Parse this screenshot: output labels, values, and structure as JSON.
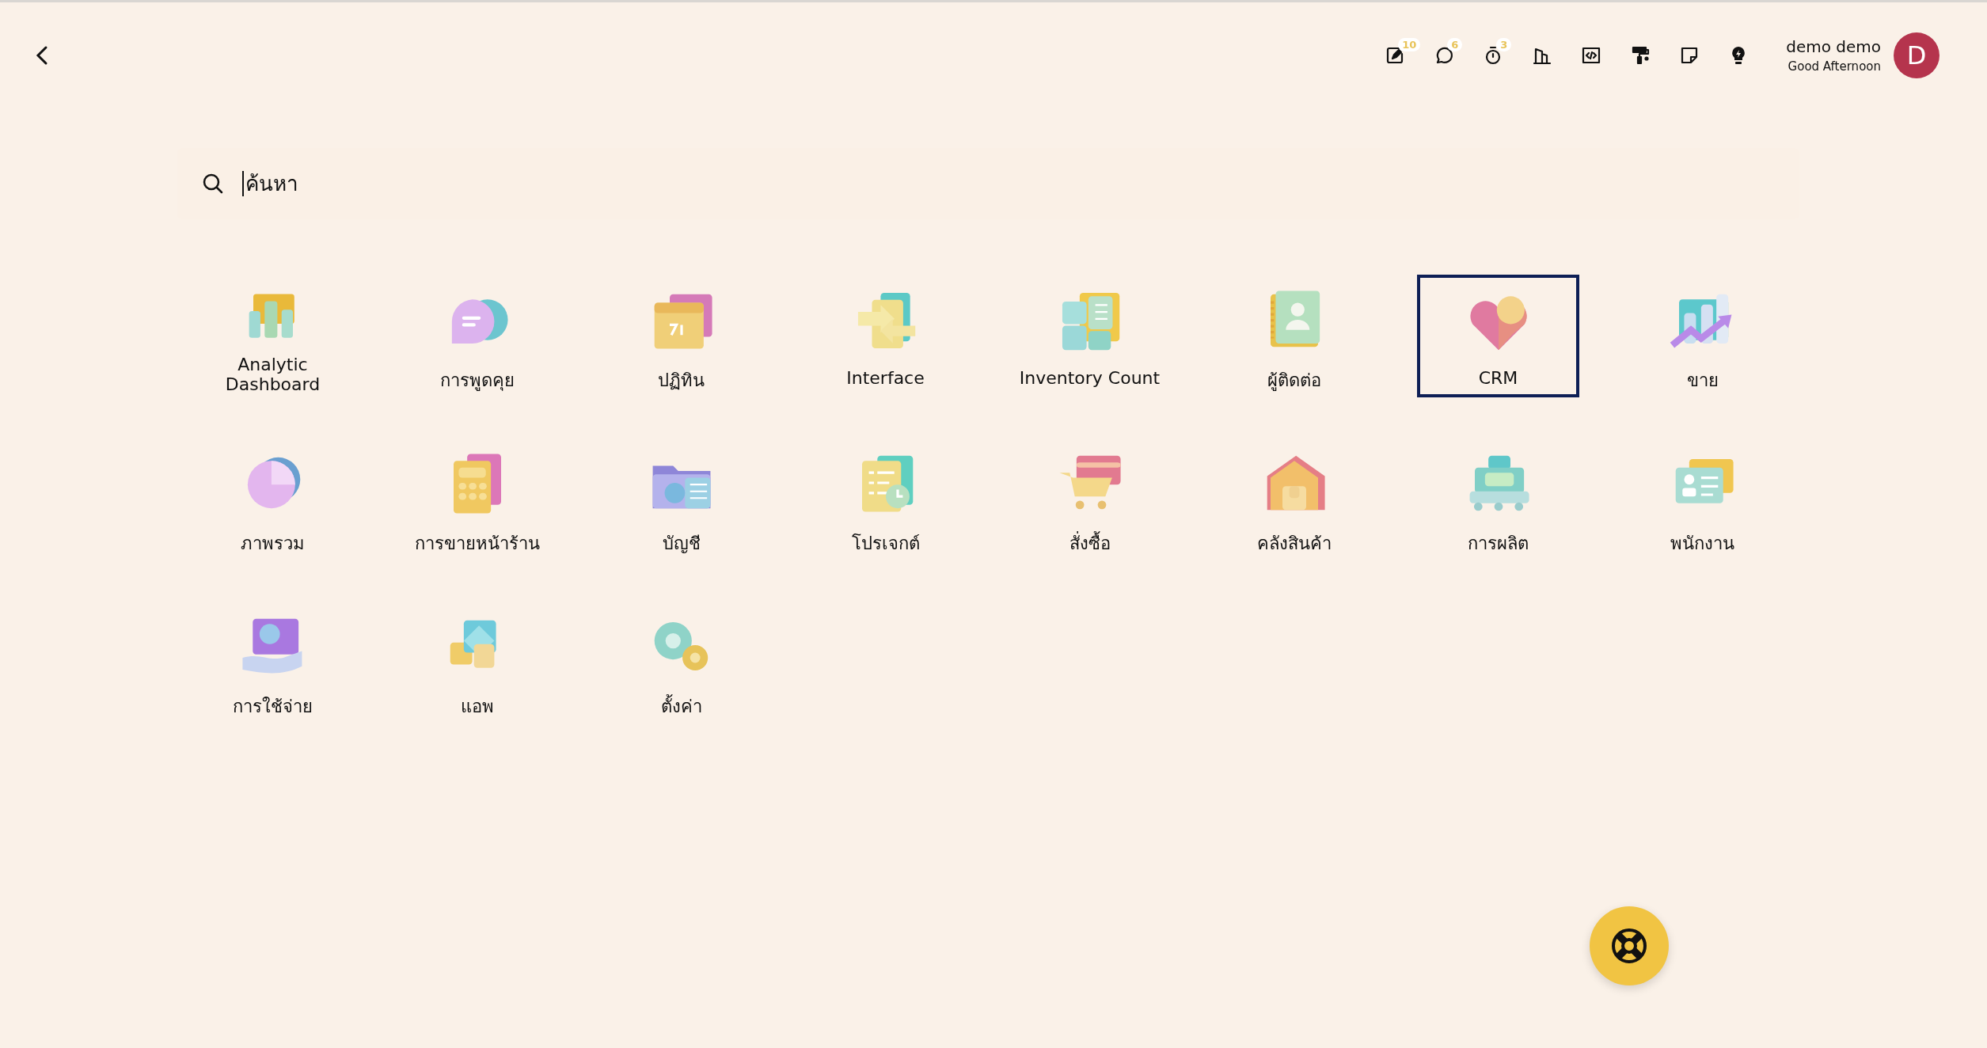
{
  "toolbar": [
    {
      "kind": "notes",
      "badge": "10"
    },
    {
      "kind": "chat",
      "badge": "6"
    },
    {
      "kind": "timer",
      "badge": "3"
    },
    {
      "kind": "company"
    },
    {
      "kind": "code"
    },
    {
      "kind": "theme"
    },
    {
      "kind": "sticky"
    },
    {
      "kind": "tips"
    }
  ],
  "user": {
    "name": "demo demo",
    "greeting": "Good Afternoon",
    "initial": "D"
  },
  "search": {
    "placeholder": "ค้นหา"
  },
  "apps": [
    {
      "label": "Analytic Dashboard",
      "selected": false
    },
    {
      "label": "การพูดคุย",
      "selected": false
    },
    {
      "label": "ปฏิทิน",
      "selected": false
    },
    {
      "label": "Interface",
      "selected": false
    },
    {
      "label": "Inventory Count",
      "selected": false
    },
    {
      "label": "ผู้ติดต่อ",
      "selected": false
    },
    {
      "label": "CRM",
      "selected": true
    },
    {
      "label": "ขาย",
      "selected": false
    },
    {
      "label": "ภาพรวม",
      "selected": false
    },
    {
      "label": "การขายหน้าร้าน",
      "selected": false
    },
    {
      "label": "บัญชี",
      "selected": false
    },
    {
      "label": "โปรเจกต์",
      "selected": false
    },
    {
      "label": "สั่งซื้อ",
      "selected": false
    },
    {
      "label": "คลังสินค้า",
      "selected": false
    },
    {
      "label": "การผลิต",
      "selected": false
    },
    {
      "label": "พนักงาน",
      "selected": false
    },
    {
      "label": "การใช้จ่าย",
      "selected": false
    },
    {
      "label": "แอพ",
      "selected": false
    },
    {
      "label": "ตั้งค่า",
      "selected": false
    }
  ]
}
